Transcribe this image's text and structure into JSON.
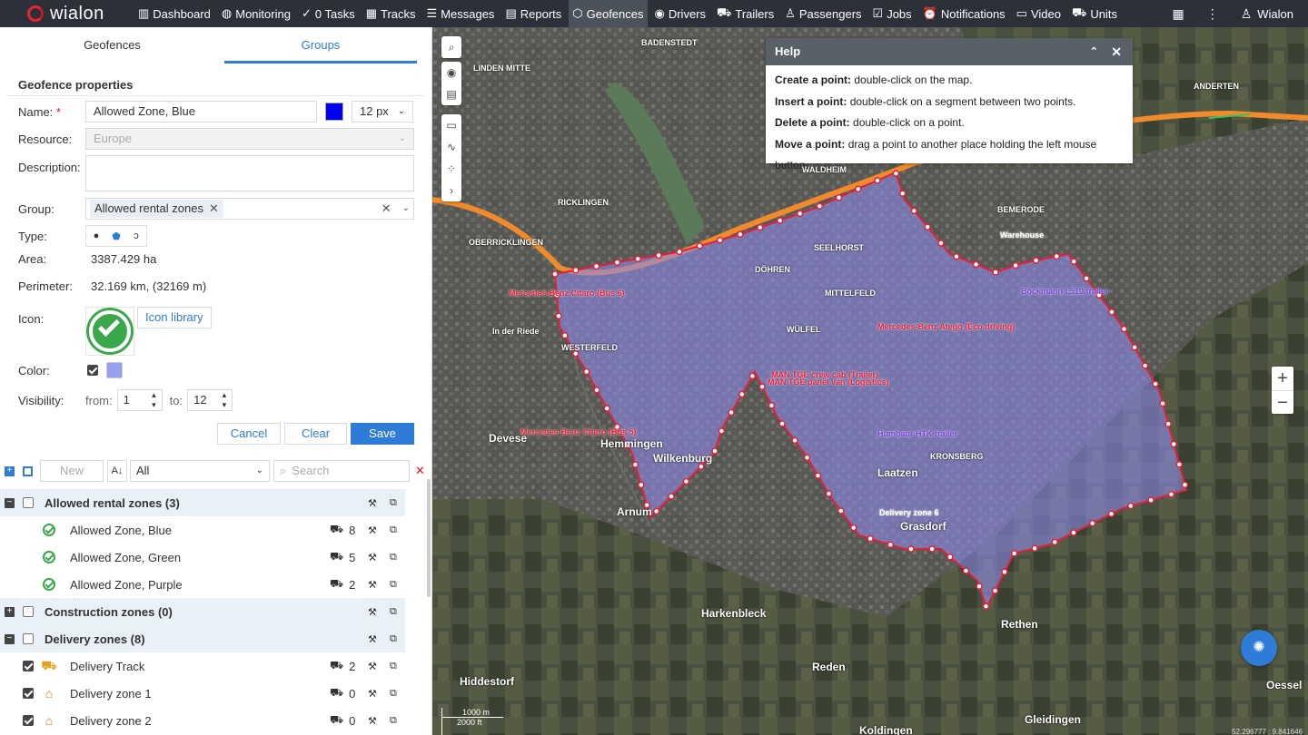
{
  "brand": "wialon",
  "nav": [
    {
      "icon": "dashboard-icon",
      "glyph": "▥",
      "label": "Dashboard"
    },
    {
      "icon": "monitoring-icon",
      "glyph": "◍",
      "label": "Monitoring"
    },
    {
      "icon": "tasks-icon",
      "glyph": "✓",
      "label": "0  Tasks"
    },
    {
      "icon": "tracks-icon",
      "glyph": "▦",
      "label": "Tracks"
    },
    {
      "icon": "messages-icon",
      "glyph": "☰",
      "label": "Messages"
    },
    {
      "icon": "reports-icon",
      "glyph": "▤",
      "label": "Reports"
    },
    {
      "icon": "geofences-icon",
      "glyph": "⬡",
      "label": "Geofences"
    },
    {
      "icon": "drivers-icon",
      "glyph": "◉",
      "label": "Drivers"
    },
    {
      "icon": "trailers-icon",
      "glyph": "⛟",
      "label": "Trailers"
    },
    {
      "icon": "passengers-icon",
      "glyph": "♙",
      "label": "Passengers"
    },
    {
      "icon": "jobs-icon",
      "glyph": "☑",
      "label": "Jobs"
    },
    {
      "icon": "notifications-icon",
      "glyph": "⏰",
      "label": "Notifications"
    },
    {
      "icon": "video-icon",
      "glyph": "▭",
      "label": "Video"
    },
    {
      "icon": "units-icon",
      "glyph": "⛟",
      "label": "Units"
    }
  ],
  "user": "Wialon",
  "tabs": {
    "geofences": "Geofences",
    "groups": "Groups"
  },
  "props": {
    "header": "Geofence properties",
    "name_label": "Name:",
    "name_required": "*",
    "name_value": "Allowed Zone, Blue",
    "name_color": "#0000ee",
    "line_width": "12 px",
    "resource_label": "Resource:",
    "resource_value": "Europe",
    "description_label": "Description:",
    "group_label": "Group:",
    "group_tag": "Allowed rental zones",
    "type_label": "Type:",
    "area_label": "Area:",
    "area_value": "3387.429 ha",
    "perimeter_label": "Perimeter:",
    "perimeter_value": "32.169 km, (32169 m)",
    "icon_label": "Icon:",
    "icon_library": "Icon library",
    "color_label": "Color:",
    "fill_color": "#9a9ef0",
    "visibility_label": "Visibility:",
    "from_label": "from:",
    "from_value": "1",
    "to_label": "to:",
    "to_value": "12"
  },
  "buttons": {
    "cancel": "Cancel",
    "clear": "Clear",
    "save": "Save"
  },
  "list_toolbar": {
    "new": "New",
    "sort": "A↓",
    "filter": "All",
    "search_placeholder": "Search"
  },
  "tree": [
    {
      "type": "group",
      "label": "Allowed rental zones (3)",
      "expanded": true
    },
    {
      "type": "item",
      "label": "Allowed Zone, Blue",
      "count": "8",
      "icon": "check-icon"
    },
    {
      "type": "item",
      "label": "Allowed Zone, Green",
      "count": "5",
      "icon": "check-icon"
    },
    {
      "type": "item",
      "label": "Allowed Zone, Purple",
      "count": "2",
      "icon": "check-icon"
    },
    {
      "type": "group",
      "label": "Construction zones (0)",
      "expanded": false
    },
    {
      "type": "group",
      "label": "Delivery zones (8)",
      "expanded": true
    },
    {
      "type": "item",
      "label": "Delivery Track",
      "count": "2",
      "icon": "truck-icon",
      "checked": true
    },
    {
      "type": "item",
      "label": "Delivery zone 1",
      "count": "0",
      "icon": "house-icon",
      "checked": true
    },
    {
      "type": "item",
      "label": "Delivery zone 2",
      "count": "0",
      "icon": "house-icon",
      "checked": true
    }
  ],
  "help": {
    "title": "Help",
    "lines": [
      {
        "bold": "Create a point:",
        "text": "double-click on the map."
      },
      {
        "bold": "Insert a point:",
        "text": "double-click on a segment between two points."
      },
      {
        "bold": "Delete a point:",
        "text": "double-click on a point."
      },
      {
        "bold": "Move a point:",
        "text": "drag a point to another place holding the left mouse button."
      }
    ]
  },
  "map": {
    "place_labels": [
      "LINDEN MITTE",
      "BADENSTEDT",
      "RICKLINGEN",
      "OBERRICKLINGEN",
      "WALDHEIM",
      "SEELHORST",
      "DÖHREN",
      "MITTELFELD",
      "WÜLFEL",
      "WESTERFELD",
      "Devese",
      "Hemmingen",
      "Wilkenburg",
      "Laatzen",
      "KRONSBERG",
      "Grasdorf",
      "Arnum",
      "Harkenbleck",
      "Rethen",
      "Hiddestorf",
      "Reden",
      "Koldingen",
      "Gleidingen",
      "Oessel",
      "BEMERODE",
      "ANDERTEN",
      "In der Riede"
    ],
    "unit_labels": [
      "Mercedes-Benz Citaro (Bus 6)",
      "Mercedes-Benz Citaro (Bus 5)",
      "Mercedes-Benz Atego (Eco driving)",
      "MAN TGE crew cab (Trailer)",
      "MAN TGE panel van (Logistics)",
      "Humbaur HTK trailer",
      "Böckmann L510 trailer",
      "Delivery zone 6",
      "Warehouse"
    ],
    "scale_top": "1000 m",
    "scale_bottom": "2000 ft",
    "coords": "52.296777 : 9.841646"
  }
}
